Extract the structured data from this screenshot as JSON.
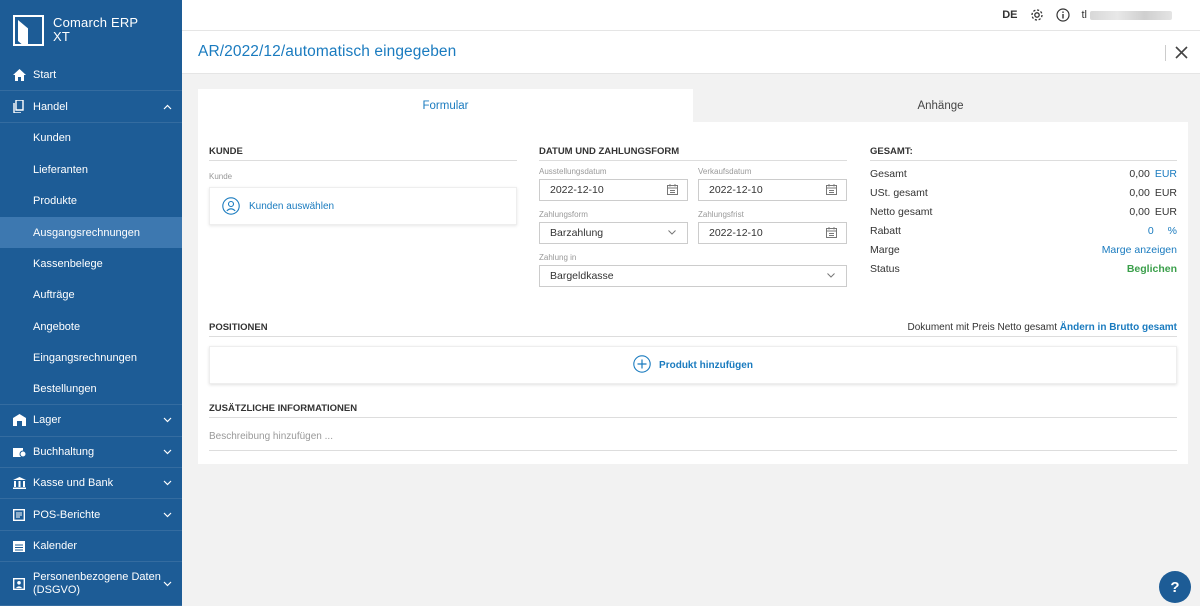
{
  "app": {
    "name_line1": "Comarch ERP",
    "name_line2": "XT"
  },
  "sidebar": {
    "start": "Start",
    "handel": "Handel",
    "sub": [
      "Kunden",
      "Lieferanten",
      "Produkte",
      "Ausgangsrechnungen",
      "Kassenbelege",
      "Aufträge",
      "Angebote",
      "Eingangsrechnungen",
      "Bestellungen"
    ],
    "lager": "Lager",
    "buchhaltung": "Buchhaltung",
    "kasse": "Kasse und Bank",
    "pos": "POS-Berichte",
    "kalender": "Kalender",
    "dsgvo_line1": "Personenbezogene Daten",
    "dsgvo_line2": "(DSGVO)"
  },
  "header": {
    "lang": "DE",
    "user_prefix": "tl"
  },
  "document": {
    "title": "AR/2022/12/automatisch eingegeben"
  },
  "tabs": {
    "formular": "Formular",
    "anhaenge": "Anhänge"
  },
  "kunde": {
    "heading": "KUNDE",
    "label": "Kunde",
    "select": "Kunden auswählen"
  },
  "datum": {
    "heading": "DATUM UND ZAHLUNGSFORM",
    "ausstellungsdatum_label": "Ausstellungsdatum",
    "ausstellungsdatum": "2022-12-10",
    "verkaufsdatum_label": "Verkaufsdatum",
    "verkaufsdatum": "2022-12-10",
    "zahlungsform_label": "Zahlungsform",
    "zahlungsform": "Barzahlung",
    "zahlungsfrist_label": "Zahlungsfrist",
    "zahlungsfrist": "2022-12-10",
    "zahlung_in_label": "Zahlung in",
    "zahlung_in": "Bargeldkasse"
  },
  "gesamt": {
    "heading": "GESAMT:",
    "gesamt_label": "Gesamt",
    "gesamt_value": "0,00",
    "gesamt_cur": "EUR",
    "ust_label": "USt. gesamt",
    "ust_value": "0,00",
    "ust_cur": "EUR",
    "netto_label": "Netto gesamt",
    "netto_value": "0,00",
    "netto_cur": "EUR",
    "rabatt_label": "Rabatt",
    "rabatt_value": "0",
    "rabatt_unit": "%",
    "marge_label": "Marge",
    "marge_link": "Marge anzeigen",
    "status_label": "Status",
    "status_value": "Beglichen"
  },
  "positionen": {
    "heading": "POSITIONEN",
    "note": "Dokument mit Preis Netto gesamt",
    "change_link": "Ändern in Brutto gesamt",
    "add_product": "Produkt hinzufügen"
  },
  "extra": {
    "heading": "ZUSÄTZLICHE INFORMATIONEN",
    "placeholder": "Beschreibung hinzufügen ..."
  },
  "help": "?"
}
